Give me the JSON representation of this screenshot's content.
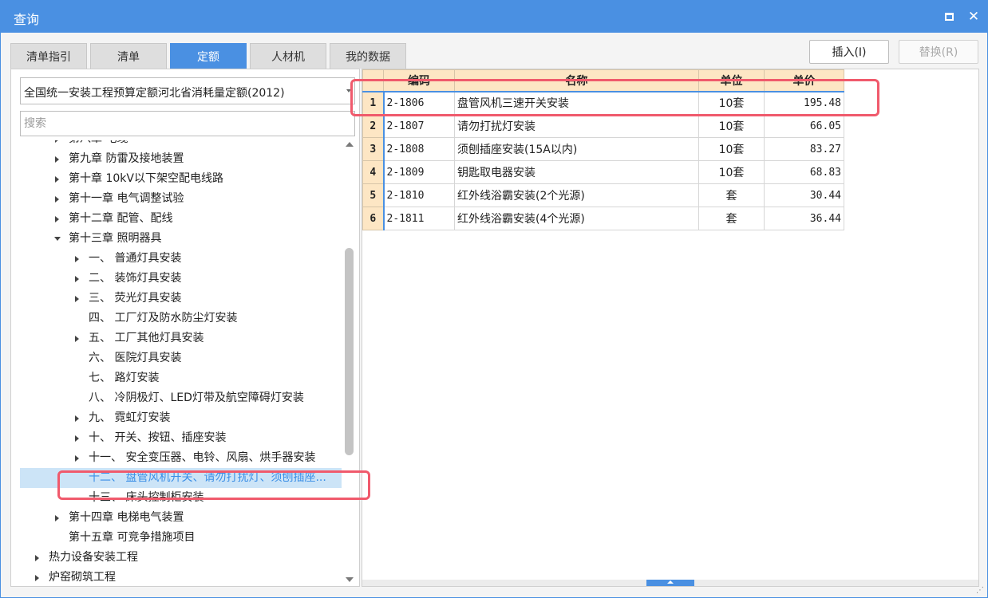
{
  "window": {
    "title": "查询"
  },
  "tabs": [
    {
      "label": "清单指引",
      "active": false
    },
    {
      "label": "清单",
      "active": false
    },
    {
      "label": "定额",
      "active": true
    },
    {
      "label": "人材机",
      "active": false
    },
    {
      "label": "我的数据",
      "active": false
    }
  ],
  "toolbar": {
    "insert_label": "插入(I)",
    "replace_label": "替换(R)"
  },
  "left": {
    "selected_library": "全国统一安装工程预算定额河北省消耗量定额(2012)",
    "search_placeholder": "搜索",
    "tree": [
      {
        "label": "第八章 电缆",
        "level": 1,
        "expandable": true,
        "expanded": false
      },
      {
        "label": "第九章 防雷及接地装置",
        "level": 1,
        "expandable": true,
        "expanded": false
      },
      {
        "label": "第十章 10kV以下架空配电线路",
        "level": 1,
        "expandable": true,
        "expanded": false
      },
      {
        "label": "第十一章 电气调整试验",
        "level": 1,
        "expandable": true,
        "expanded": false
      },
      {
        "label": "第十二章 配管、配线",
        "level": 1,
        "expandable": true,
        "expanded": false
      },
      {
        "label": "第十三章 照明器具",
        "level": 1,
        "expandable": true,
        "expanded": true
      },
      {
        "label": "一、 普通灯具安装",
        "level": 2,
        "expandable": true,
        "expanded": false
      },
      {
        "label": "二、 装饰灯具安装",
        "level": 2,
        "expandable": true,
        "expanded": false
      },
      {
        "label": "三、 荧光灯具安装",
        "level": 2,
        "expandable": true,
        "expanded": false
      },
      {
        "label": "四、 工厂灯及防水防尘灯安装",
        "level": 2,
        "expandable": false,
        "expanded": false
      },
      {
        "label": "五、 工厂其他灯具安装",
        "level": 2,
        "expandable": true,
        "expanded": false
      },
      {
        "label": "六、 医院灯具安装",
        "level": 2,
        "expandable": false,
        "expanded": false
      },
      {
        "label": "七、 路灯安装",
        "level": 2,
        "expandable": false,
        "expanded": false
      },
      {
        "label": "八、 冷阴极灯、LED灯带及航空障碍灯安装",
        "level": 2,
        "expandable": false,
        "expanded": false
      },
      {
        "label": "九、 霓虹灯安装",
        "level": 2,
        "expandable": true,
        "expanded": false
      },
      {
        "label": "十、 开关、按钮、插座安装",
        "level": 2,
        "expandable": true,
        "expanded": false
      },
      {
        "label": "十一、 安全变压器、电铃、风扇、烘手器安装",
        "level": 2,
        "expandable": true,
        "expanded": false
      },
      {
        "label": "十二、 盘管风机开关、请勿打扰灯、须刨插座...",
        "level": 2,
        "expandable": false,
        "expanded": false,
        "selected": true
      },
      {
        "label": "十三、 床头控制柜安装",
        "level": 2,
        "expandable": false,
        "expanded": false
      },
      {
        "label": "第十四章 电梯电气装置",
        "level": 1,
        "expandable": true,
        "expanded": false
      },
      {
        "label": "第十五章 可竞争措施项目",
        "level": 1,
        "expandable": false,
        "expanded": false
      },
      {
        "label": "热力设备安装工程",
        "level": 0,
        "expandable": true,
        "expanded": false
      },
      {
        "label": "炉窑砌筑工程",
        "level": 0,
        "expandable": true,
        "expanded": false
      }
    ]
  },
  "grid": {
    "columns": [
      "编码",
      "名称",
      "单位",
      "单价"
    ],
    "rows": [
      {
        "no": "1",
        "code": "2-1806",
        "name": "盘管风机三速开关安装",
        "unit": "10套",
        "price": "195.48"
      },
      {
        "no": "2",
        "code": "2-1807",
        "name": "请勿打扰灯安装",
        "unit": "10套",
        "price": "66.05"
      },
      {
        "no": "3",
        "code": "2-1808",
        "name": "须刨插座安装(15A以内)",
        "unit": "10套",
        "price": "83.27"
      },
      {
        "no": "4",
        "code": "2-1809",
        "name": "钥匙取电器安装",
        "unit": "10套",
        "price": "68.83"
      },
      {
        "no": "5",
        "code": "2-1810",
        "name": "红外线浴霸安装(2个光源)",
        "unit": "套",
        "price": "30.44"
      },
      {
        "no": "6",
        "code": "2-1811",
        "name": "红外线浴霸安装(4个光源)",
        "unit": "套",
        "price": "36.44"
      }
    ]
  },
  "colors": {
    "accent": "#4a90e2",
    "header_bg": "#fde6c4",
    "selection_bg": "#cce4f7",
    "annotation": "#f05a6c"
  }
}
